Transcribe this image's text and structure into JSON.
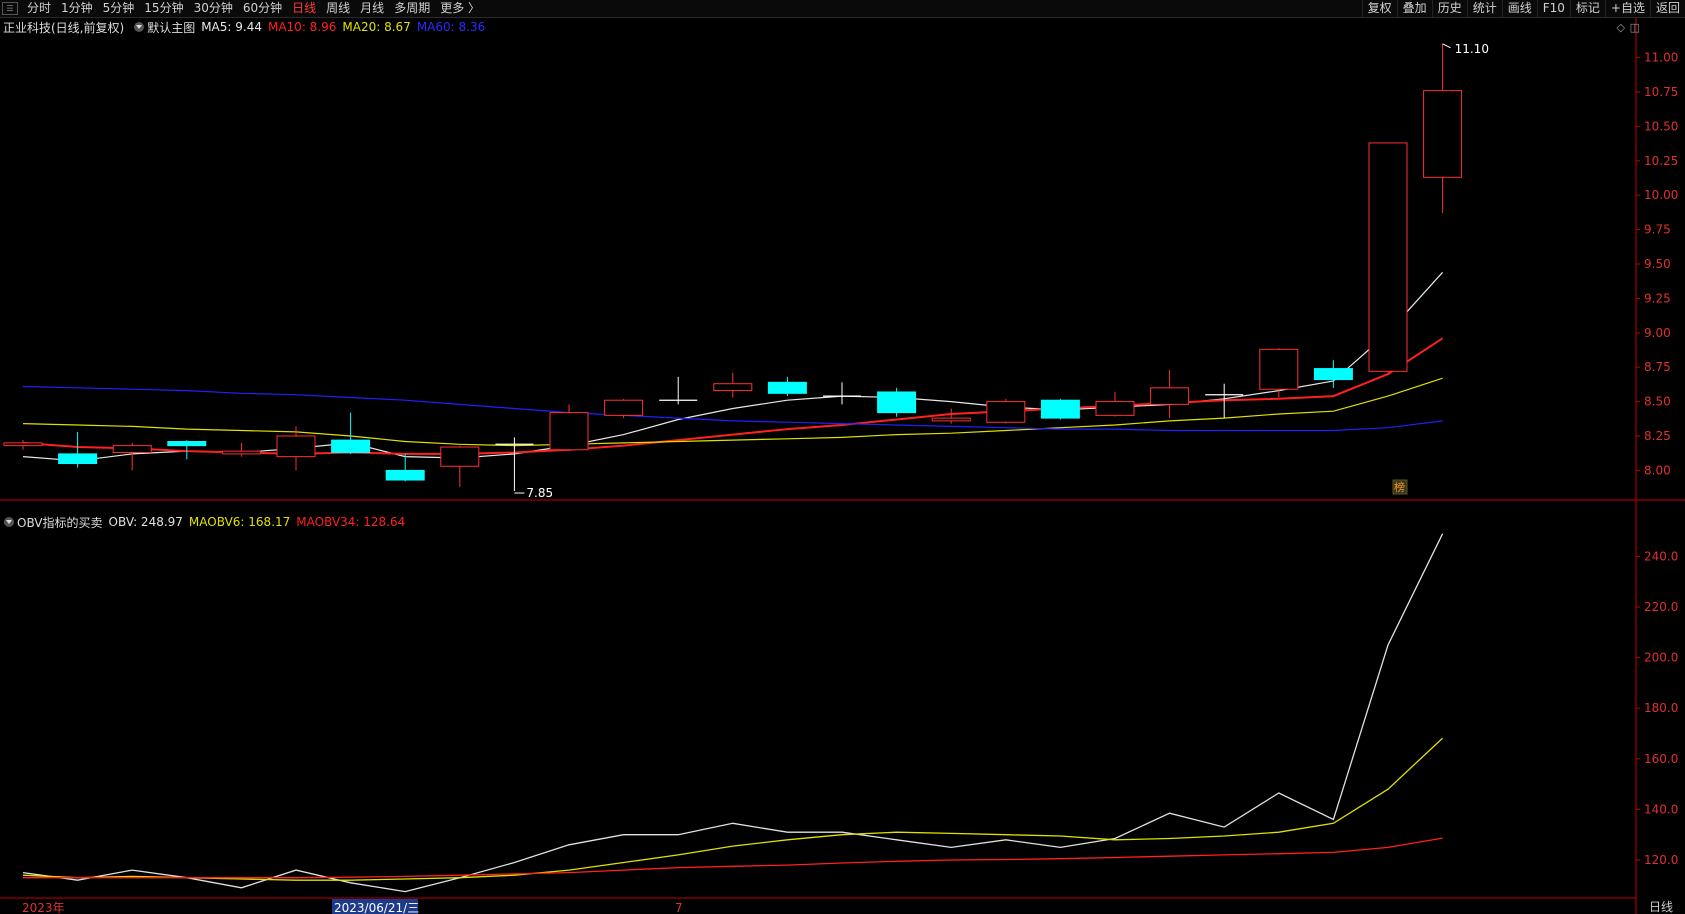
{
  "toolbar": {
    "tabs": [
      "分时",
      "1分钟",
      "5分钟",
      "15分钟",
      "30分钟",
      "60分钟",
      "日线",
      "周线",
      "月线",
      "多周期",
      "更多 〉"
    ],
    "active_tab": "日线",
    "right_tools": [
      "复权",
      "叠加",
      "历史",
      "统计",
      "画线",
      "F10",
      "标记",
      "+自选",
      "返回"
    ]
  },
  "main_legend": {
    "title": "正业科技(日线,前复权)",
    "template": "默认主图",
    "ma5": "MA5: 9.44",
    "ma10": "MA10: 8.96",
    "ma20": "MA20: 8.67",
    "ma60": "MA60: 8.36"
  },
  "sub_legend": {
    "title": "OBV指标的买卖",
    "obv": "OBV: 248.97",
    "maobv6": "MAOBV6: 168.17",
    "maobv34": "MAOBV34: 128.64"
  },
  "annotations": {
    "high_label": "11.10",
    "low_label": "7.85",
    "bang_mark": "榜"
  },
  "date_labels": [
    "2023年",
    "2023/06/21/三",
    "7"
  ],
  "footer_right": "日线",
  "colors": {
    "up": "#ff3030",
    "down": "#00ffff",
    "ma5": "#e8e8e8",
    "ma10": "#ff2020",
    "ma20": "#e0e000",
    "ma60": "#2020ff",
    "axis_red": "#c00000",
    "obv": "#e0e0e0",
    "maobv6": "#e0e000",
    "maobv34": "#ff2020"
  },
  "chart_data": [
    {
      "type": "candlestick",
      "y_ticks": [
        8.0,
        8.25,
        8.5,
        8.75,
        9.0,
        9.25,
        9.5,
        9.75,
        10.0,
        10.25,
        10.5,
        10.75,
        11.0
      ],
      "ylim": [
        7.85,
        11.1
      ],
      "candles": [
        {
          "o": 8.18,
          "h": 8.22,
          "l": 8.15,
          "c": 8.2
        },
        {
          "o": 8.12,
          "h": 8.28,
          "l": 8.02,
          "c": 8.05
        },
        {
          "o": 8.13,
          "h": 8.2,
          "l": 8.0,
          "c": 8.18
        },
        {
          "o": 8.21,
          "h": 8.22,
          "l": 8.08,
          "c": 8.18
        },
        {
          "o": 8.12,
          "h": 8.2,
          "l": 8.1,
          "c": 8.14
        },
        {
          "o": 8.1,
          "h": 8.32,
          "l": 8.0,
          "c": 8.25
        },
        {
          "o": 8.22,
          "h": 8.42,
          "l": 8.12,
          "c": 8.13
        },
        {
          "o": 8.0,
          "h": 8.12,
          "l": 7.92,
          "c": 7.93
        },
        {
          "o": 8.03,
          "h": 8.18,
          "l": 7.88,
          "c": 8.17
        },
        {
          "o": 8.19,
          "h": 8.24,
          "l": 7.85,
          "c": 8.18
        },
        {
          "o": 8.15,
          "h": 8.48,
          "l": 8.14,
          "c": 8.42
        },
        {
          "o": 8.4,
          "h": 8.52,
          "l": 8.38,
          "c": 8.51
        },
        {
          "o": 8.51,
          "h": 8.68,
          "l": 8.48,
          "c": 8.5
        },
        {
          "o": 8.58,
          "h": 8.71,
          "l": 8.53,
          "c": 8.63
        },
        {
          "o": 8.64,
          "h": 8.68,
          "l": 8.54,
          "c": 8.56
        },
        {
          "o": 8.54,
          "h": 8.64,
          "l": 8.48,
          "c": 8.54
        },
        {
          "o": 8.57,
          "h": 8.6,
          "l": 8.39,
          "c": 8.42
        },
        {
          "o": 8.36,
          "h": 8.45,
          "l": 8.34,
          "c": 8.38
        },
        {
          "o": 8.35,
          "h": 8.52,
          "l": 8.34,
          "c": 8.5
        },
        {
          "o": 8.51,
          "h": 8.52,
          "l": 8.37,
          "c": 8.38
        },
        {
          "o": 8.4,
          "h": 8.57,
          "l": 8.39,
          "c": 8.5
        },
        {
          "o": 8.48,
          "h": 8.73,
          "l": 8.38,
          "c": 8.6
        },
        {
          "o": 8.55,
          "h": 8.63,
          "l": 8.38,
          "c": 8.55
        },
        {
          "o": 8.59,
          "h": 8.89,
          "l": 8.53,
          "c": 8.88
        },
        {
          "o": 8.74,
          "h": 8.8,
          "l": 8.6,
          "c": 8.66
        },
        {
          "o": 8.72,
          "h": 10.38,
          "l": 8.71,
          "c": 10.38
        },
        {
          "o": 10.13,
          "h": 11.1,
          "l": 9.87,
          "c": 10.76
        }
      ],
      "series": [
        {
          "name": "MA5",
          "values": [
            8.1,
            8.07,
            8.12,
            8.14,
            8.13,
            8.16,
            8.2,
            8.1,
            8.09,
            8.12,
            8.18,
            8.26,
            8.37,
            8.45,
            8.51,
            8.54,
            8.53,
            8.5,
            8.46,
            8.44,
            8.46,
            8.48,
            8.52,
            8.58,
            8.65,
            9.0,
            9.44
          ]
        },
        {
          "name": "MA10",
          "values": [
            8.2,
            8.17,
            8.16,
            8.14,
            8.13,
            8.12,
            8.13,
            8.12,
            8.12,
            8.13,
            8.15,
            8.18,
            8.22,
            8.26,
            8.3,
            8.33,
            8.37,
            8.41,
            8.43,
            8.45,
            8.47,
            8.49,
            8.51,
            8.52,
            8.54,
            8.7,
            8.96
          ]
        },
        {
          "name": "MA20",
          "values": [
            8.34,
            8.33,
            8.32,
            8.3,
            8.29,
            8.28,
            8.25,
            8.21,
            8.19,
            8.18,
            8.19,
            8.2,
            8.21,
            8.22,
            8.23,
            8.24,
            8.26,
            8.27,
            8.29,
            8.31,
            8.33,
            8.36,
            8.38,
            8.41,
            8.43,
            8.54,
            8.67
          ]
        },
        {
          "name": "MA60",
          "values": [
            8.61,
            8.6,
            8.59,
            8.58,
            8.56,
            8.55,
            8.53,
            8.51,
            8.48,
            8.45,
            8.42,
            8.4,
            8.38,
            8.36,
            8.35,
            8.34,
            8.33,
            8.32,
            8.31,
            8.3,
            8.3,
            8.29,
            8.29,
            8.29,
            8.29,
            8.31,
            8.36
          ]
        }
      ]
    },
    {
      "type": "line",
      "y_ticks": [
        120.0,
        140.0,
        160.0,
        180.0,
        200.0,
        220.0,
        240.0
      ],
      "ylim": [
        108,
        250
      ],
      "series": [
        {
          "name": "OBV",
          "values": [
            115.0,
            112.0,
            116.0,
            113.0,
            109.0,
            116.0,
            111.0,
            107.5,
            113.0,
            119.0,
            126.0,
            130.0,
            130.0,
            134.5,
            131.0,
            131.0,
            128.0,
            125.0,
            128.0,
            125.0,
            128.5,
            138.5,
            133.0,
            146.5,
            136.0,
            205.0,
            248.97
          ]
        },
        {
          "name": "MAOBV6",
          "values": [
            114.0,
            113.0,
            113.5,
            113.0,
            112.5,
            112.0,
            112.0,
            112.5,
            113.0,
            114.0,
            116.0,
            119.0,
            122.0,
            125.5,
            128.0,
            130.0,
            131.0,
            130.5,
            130.0,
            129.5,
            128.0,
            128.5,
            129.5,
            131.0,
            134.5,
            148.0,
            168.17
          ]
        },
        {
          "name": "MAOBV34",
          "values": [
            113.0,
            113.0,
            113.0,
            113.0,
            113.0,
            113.0,
            113.2,
            113.5,
            114.0,
            114.5,
            115.0,
            116.0,
            117.0,
            117.5,
            118.0,
            118.8,
            119.5,
            120.0,
            120.2,
            120.5,
            121.0,
            121.5,
            122.0,
            122.5,
            123.0,
            125.0,
            128.64
          ]
        }
      ]
    }
  ]
}
